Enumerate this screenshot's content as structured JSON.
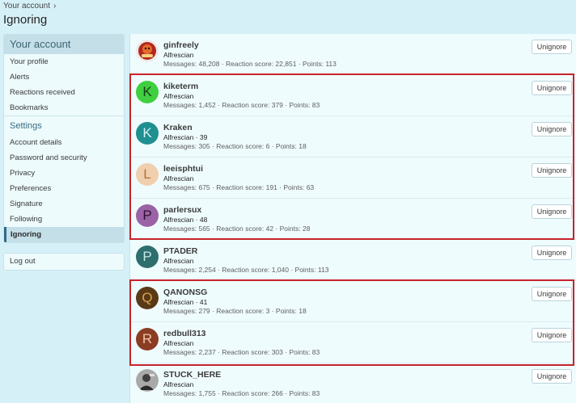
{
  "breadcrumb": {
    "label": "Your account",
    "sep": "›"
  },
  "page_title": "Ignoring",
  "sidebar": {
    "header": "Your account",
    "items": [
      "Your profile",
      "Alerts",
      "Reactions received",
      "Bookmarks"
    ],
    "settings_header": "Settings",
    "settings_items": [
      "Account details",
      "Password and security",
      "Privacy",
      "Preferences",
      "Signature",
      "Following",
      "Ignoring"
    ],
    "logout": "Log out"
  },
  "button_label": "Unignore",
  "users": [
    {
      "name": "ginfreely",
      "title": "Alfrescian",
      "stats": "Messages: 48,208 · Reaction score: 22,851 · Points: 113",
      "avatar": "image",
      "color": "#c0392b"
    },
    {
      "name": "kiketerm",
      "title": "Alfrescian",
      "stats": "Messages: 1,452 · Reaction score: 379 · Points: 83",
      "letter": "K",
      "color": "#3fcf3f",
      "text_color": "#183d18"
    },
    {
      "name": "Kraken",
      "title": "Alfrescian · 39",
      "stats": "Messages: 305 · Reaction score: 6 · Points: 18",
      "letter": "K",
      "color": "#1f8f8f",
      "text_color": "#d6f3f3"
    },
    {
      "name": "leeisphtui",
      "title": "Alfrescian",
      "stats": "Messages: 675 · Reaction score: 191 · Points: 63",
      "letter": "L",
      "color": "#f0cfae",
      "text_color": "#b5713c"
    },
    {
      "name": "parlersux",
      "title": "Alfrescian · 48",
      "stats": "Messages: 565 · Reaction score: 42 · Points: 28",
      "letter": "P",
      "color": "#9b63a5",
      "text_color": "#2e0f35"
    },
    {
      "name": "PTADER",
      "title": "Alfrescian",
      "stats": "Messages: 2,254 · Reaction score: 1,040 · Points: 113",
      "letter": "P",
      "color": "#2f6e6e",
      "text_color": "#c7e6e6"
    },
    {
      "name": "QANONSG",
      "title": "Alfrescian · 41",
      "stats": "Messages: 279 · Reaction score: 3 · Points: 18",
      "letter": "Q",
      "color": "#5a3a16",
      "text_color": "#d9a24e"
    },
    {
      "name": "redbull313",
      "title": "Alfrescian",
      "stats": "Messages: 2,237 · Reaction score: 303 · Points: 83",
      "letter": "R",
      "color": "#8a3d22",
      "text_color": "#f0c7a7"
    },
    {
      "name": "STUCK_HERE",
      "title": "Alfrescian",
      "stats": "Messages: 1,755 · Reaction score: 266 · Points: 83",
      "avatar": "image",
      "color": "#5c5c5c"
    }
  ],
  "highlight_color": "#c7232b"
}
